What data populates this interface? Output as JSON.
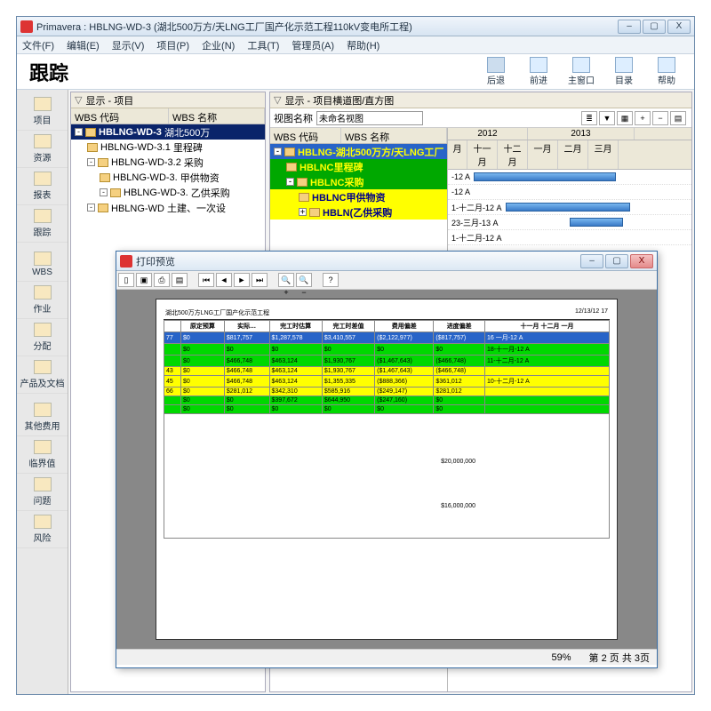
{
  "app": {
    "title": "Primavera : HBLNG-WD-3 (湖北500万方/天LNG工厂国产化示范工程110kV变电所工程)"
  },
  "menu": [
    "文件(F)",
    "编辑(E)",
    "显示(V)",
    "项目(P)",
    "企业(N)",
    "工具(T)",
    "管理员(A)",
    "帮助(H)"
  ],
  "header": {
    "title": "跟踪",
    "tools": [
      {
        "label": "后退"
      },
      {
        "label": "前进"
      },
      {
        "label": "主窗口"
      },
      {
        "label": "目录"
      },
      {
        "label": "帮助"
      }
    ]
  },
  "vtoolbar": [
    "项目",
    "资源",
    "报表",
    "跟踪",
    "WBS",
    "作业",
    "分配",
    "产品及文档",
    "其他费用",
    "临界值",
    "问题",
    "风险"
  ],
  "leftPane": {
    "title": "显示 - 项目",
    "cols": [
      "WBS 代码",
      "WBS 名称"
    ],
    "rows": [
      {
        "code": "HBLNG-WD-3",
        "name": "湖北500万",
        "sel": true,
        "indent": 0
      },
      {
        "code": "HBLNG-WD-3.1",
        "name": "里程碑",
        "indent": 1
      },
      {
        "code": "HBLNG-WD-3.2",
        "name": "采购",
        "indent": 1
      },
      {
        "code": "HBLNG-WD-3.",
        "name": "甲供物资",
        "indent": 2
      },
      {
        "code": "HBLNG-WD-3.",
        "name": "乙供采购",
        "indent": 2
      },
      {
        "code": "HBLNG-WD 土建、一次设",
        "name": "",
        "indent": 1
      }
    ]
  },
  "rightPane": {
    "title": "显示 - 项目横道图/直方图",
    "viewLabel": "视图名称",
    "viewValue": "未命名视图",
    "cols": [
      "WBS 代码",
      "WBS 名称"
    ],
    "rows": [
      {
        "text": "HBLNG-湖北500万方/天LNG工厂",
        "cls": "blue"
      },
      {
        "text": "HBLNC里程碑",
        "cls": "green",
        "indent": 1
      },
      {
        "text": "HBLNC采购",
        "cls": "green",
        "indent": 1
      },
      {
        "text": "HBLNC甲供物资",
        "cls": "yellow",
        "indent": 2
      },
      {
        "text": "HBLN(乙供采购",
        "cls": "yellow",
        "indent": 2
      }
    ],
    "timeline": {
      "years": [
        "2012",
        "2013"
      ],
      "months": [
        "月",
        "十一月",
        "十二月",
        "一月",
        "二月",
        "三月"
      ],
      "labels": [
        "-12 A",
        "-12 A",
        "1-十二月-12 A",
        "23-三月-13 A",
        "1-十二月-12 A"
      ]
    }
  },
  "preview": {
    "title": "打印预览",
    "zoom": "59%",
    "page": "第 2 页 共 3页",
    "tableTitle": "湖北500万方LNG工厂国产化示范工程",
    "date": "12/13/12 17",
    "headers": [
      "原定预算",
      "实际…",
      "完工时估算",
      "完工时差值",
      "费用偏差",
      "进度偏差"
    ],
    "rows": [
      {
        "cls": "r-blue",
        "c": [
          "77",
          "$0",
          "$817,757",
          "$1,287,578",
          "$3,410,557",
          "($2,122,977)",
          "($817,757)"
        ]
      },
      {
        "cls": "r-green",
        "c": [
          "",
          "$0",
          "$0",
          "$0",
          "$0",
          "$0",
          "$0"
        ]
      },
      {
        "cls": "r-green",
        "c": [
          "",
          "$0",
          "$466,748",
          "$463,124",
          "$1,930,767",
          "($1,467,643)",
          "($466,748)"
        ]
      },
      {
        "cls": "r-yellow",
        "c": [
          "43",
          "$0",
          "$466,748",
          "$463,124",
          "$1,930,767",
          "($1,467,643)",
          "($466,748)"
        ]
      },
      {
        "cls": "r-yellow",
        "c": [
          "45",
          "$0",
          "$466,748",
          "$463,124",
          "$1,355,335",
          "($888,366)",
          "$361,012"
        ]
      },
      {
        "cls": "r-yellow",
        "c": [
          "66",
          "$0",
          "$281,012",
          "$342,310",
          "$585,916",
          "($249,147)",
          "$281,012"
        ]
      },
      {
        "cls": "r-green",
        "c": [
          "",
          "$0",
          "$0",
          "$397,672",
          "$644,950",
          "($247,160)",
          "$0"
        ]
      },
      {
        "cls": "r-green",
        "c": [
          "",
          "$0",
          "$0",
          "$0",
          "$0",
          "$0",
          "$0"
        ]
      }
    ],
    "axisLabels": [
      "$20,000,000",
      "$16,000,000"
    ],
    "ganttLabels": [
      "十一月",
      "十二月",
      "一月",
      "16 一月-12 A",
      "18-十一月-12 A",
      "11-十二月-12 A",
      "10-十二月-12 A"
    ]
  }
}
